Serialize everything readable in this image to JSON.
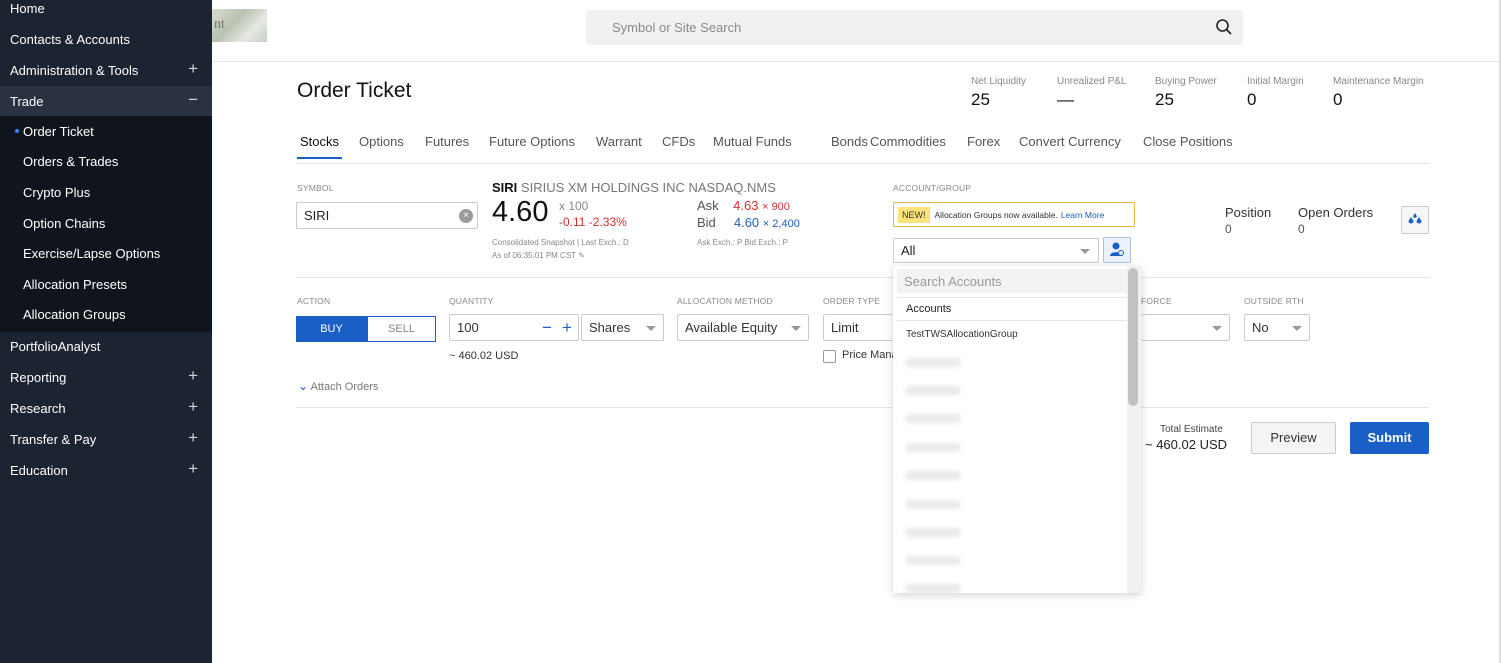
{
  "sidebar": {
    "items": [
      {
        "label": "Home",
        "expand": ""
      },
      {
        "label": "Contacts & Accounts",
        "expand": ""
      },
      {
        "label": "Administration & Tools",
        "expand": "+"
      },
      {
        "label": "Trade",
        "expand": "−"
      },
      {
        "label": "PortfolioAnalyst",
        "expand": ""
      },
      {
        "label": "Reporting",
        "expand": "+"
      },
      {
        "label": "Research",
        "expand": "+"
      },
      {
        "label": "Transfer & Pay",
        "expand": "+"
      },
      {
        "label": "Education",
        "expand": "+"
      }
    ],
    "trade_sub": [
      "Order Ticket",
      "Orders & Trades",
      "Crypto Plus",
      "Option Chains",
      "Exercise/Lapse Options",
      "Allocation Presets",
      "Allocation Groups"
    ],
    "active_sub": "Order Ticket"
  },
  "logo_fragment": "nt",
  "search": {
    "placeholder": "Symbol or Site Search"
  },
  "page_title": "Order Ticket",
  "metrics": [
    {
      "label": "Net Liquidity",
      "value": "25"
    },
    {
      "label": "Unrealized P&L",
      "value": "—"
    },
    {
      "label": "Buying Power",
      "value": "25"
    },
    {
      "label": "Initial Margin",
      "value": "0"
    },
    {
      "label": "Maintenance Margin",
      "value": "0"
    }
  ],
  "tabs": [
    "Stocks",
    "Options",
    "Futures",
    "Future Options",
    "Warrant",
    "CFDs",
    "Mutual Funds",
    "Bonds",
    "Commodities",
    "Forex",
    "Convert Currency",
    "Close Positions"
  ],
  "active_tab": "Stocks",
  "symbol": {
    "label": "SYMBOL",
    "value": "SIRI"
  },
  "quote": {
    "ticker": "SIRI",
    "description": "SIRIUS XM HOLDINGS INC NASDAQ.NMS",
    "last": "4.60",
    "multiplier": "x 100",
    "change": "-0.11 -2.33%",
    "snapshot": "Consolidated Snapshot  |  Last Exch.: D",
    "as_of": "As of 06:35:01 PM CST",
    "ask_label": "Ask",
    "ask_price": "4.63",
    "ask_size": "900",
    "bid_label": "Bid",
    "bid_price": "4.60",
    "bid_size": "2,400",
    "exch": "Ask Exch.: P  Bid Exch.: P",
    "size_sep": "×"
  },
  "account": {
    "label": "ACCOUNT/GROUP",
    "notice_badge": "NEW!",
    "notice_text": "Allocation Groups now available.",
    "notice_link": "Learn More",
    "selected": "All"
  },
  "position": {
    "label": "Position",
    "value": "0"
  },
  "open_orders": {
    "label": "Open Orders",
    "value": "0"
  },
  "order": {
    "action_label": "ACTION",
    "buy": "BUY",
    "sell": "SELL",
    "quantity_label": "QUANTITY",
    "quantity": "100",
    "qty_minus": "−",
    "qty_plus": "+",
    "unit": "Shares",
    "approx_value": "~ 460.02 USD",
    "alloc_label": "ALLOCATION METHOD",
    "alloc": "Available Equity",
    "type_label": "ORDER TYPE",
    "type": "Limit",
    "price_manage": "Price Mana",
    "tif_label": "FORCE",
    "outside_label": "OUTSIDE RTH",
    "outside": "No",
    "attach": "Attach Orders"
  },
  "total": {
    "label": "Total Estimate",
    "value": "~ 460.02 USD"
  },
  "buttons": {
    "preview": "Preview",
    "submit": "Submit"
  },
  "dropdown": {
    "search_placeholder": "Search Accounts",
    "header": "Accounts",
    "items": [
      "TestTWSAllocationGroup"
    ]
  }
}
